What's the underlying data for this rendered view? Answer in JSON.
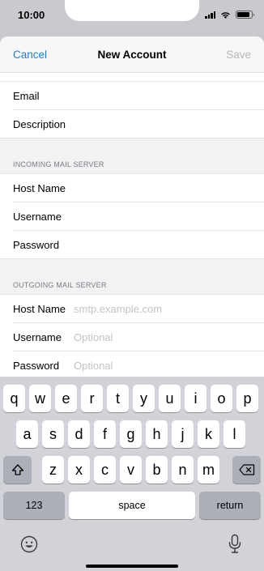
{
  "status_bar": {
    "time": "10:00"
  },
  "nav": {
    "cancel": "Cancel",
    "title": "New Account",
    "save": "Save"
  },
  "form": {
    "top_rows": [
      {
        "label": "Email"
      },
      {
        "label": "Description"
      }
    ],
    "incoming": {
      "header": "INCOMING MAIL SERVER",
      "rows": [
        {
          "label": "Host Name"
        },
        {
          "label": "Username"
        },
        {
          "label": "Password"
        }
      ]
    },
    "outgoing": {
      "header": "OUTGOING MAIL SERVER",
      "rows": [
        {
          "label": "Host Name",
          "placeholder": "smtp.example.com"
        },
        {
          "label": "Username",
          "placeholder": "Optional"
        },
        {
          "label": "Password",
          "placeholder": "Optional"
        }
      ]
    }
  },
  "keyboard": {
    "row1": [
      "q",
      "w",
      "e",
      "r",
      "t",
      "y",
      "u",
      "i",
      "o",
      "p"
    ],
    "row2": [
      "a",
      "s",
      "d",
      "f",
      "g",
      "h",
      "j",
      "k",
      "l"
    ],
    "row3": [
      "z",
      "x",
      "c",
      "v",
      "b",
      "n",
      "m"
    ],
    "numbers_key": "123",
    "space_key": "space",
    "return_key": "return",
    "icons": {
      "shift": "shift-icon",
      "delete": "delete-icon",
      "emoji": "emoji-icon",
      "mic": "microphone-icon"
    }
  },
  "colors": {
    "accent": "#1a7ee0",
    "disabled": "#b7b7b7",
    "placeholder": "#c3c3c7"
  }
}
